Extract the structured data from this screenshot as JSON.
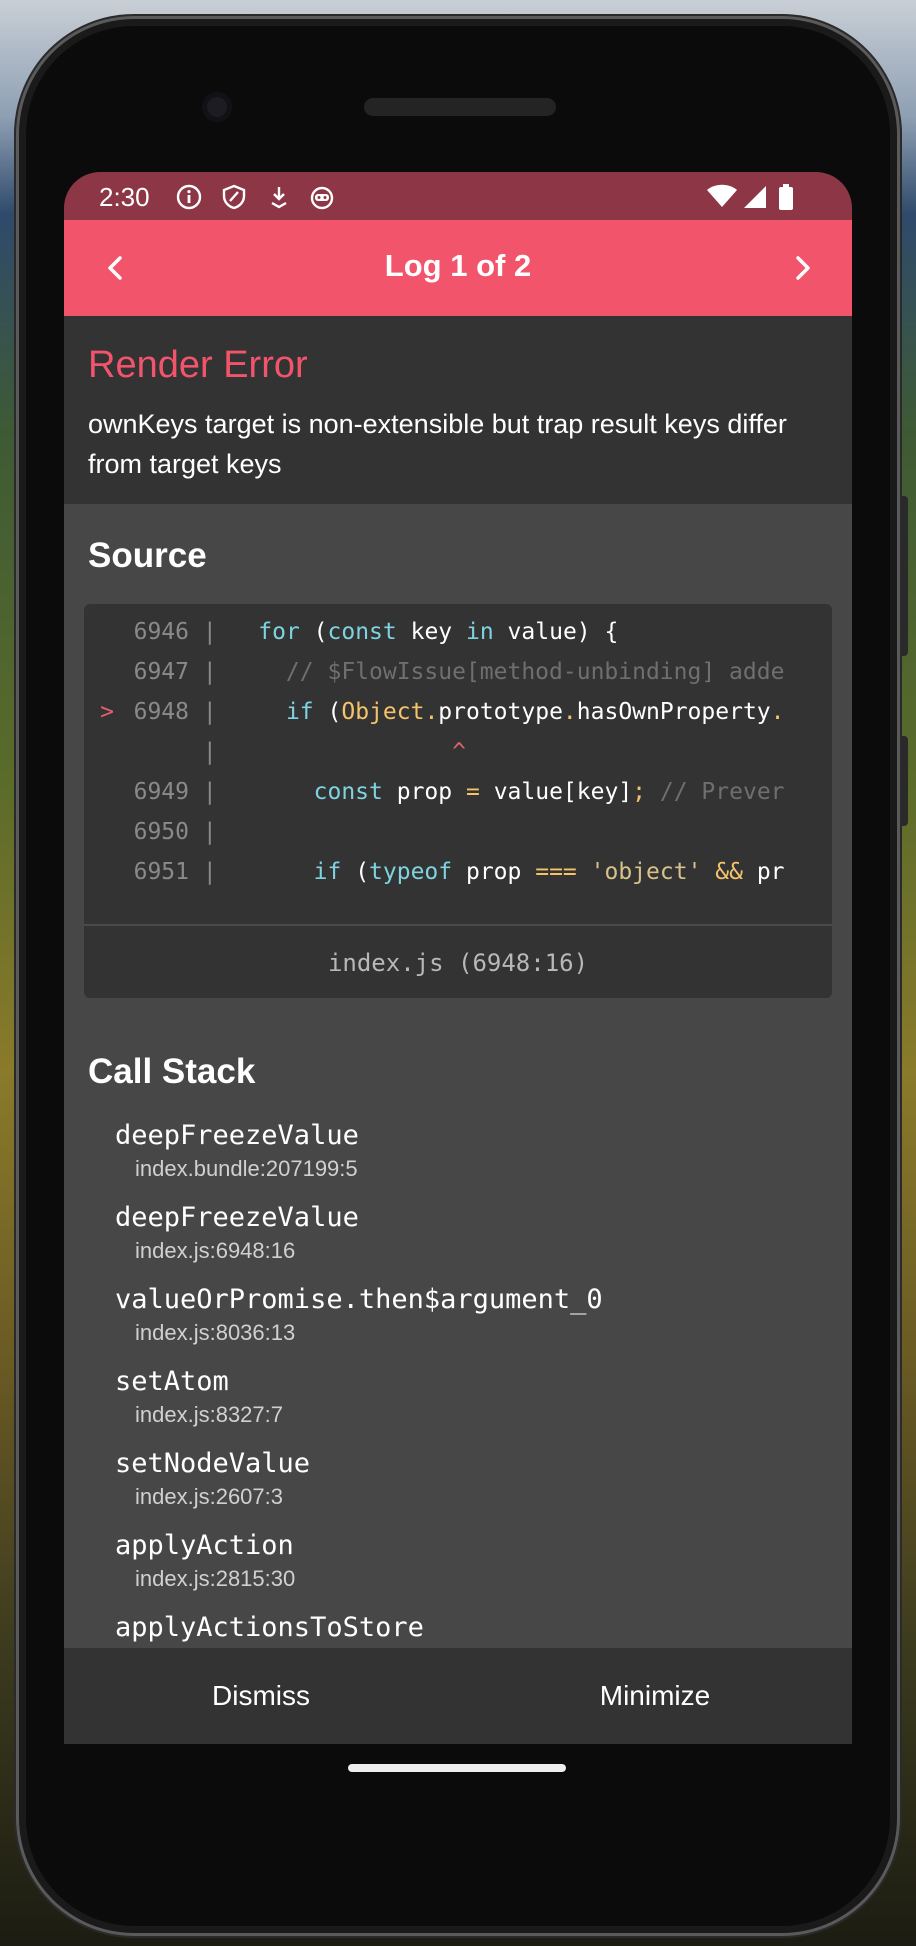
{
  "status_bar": {
    "time": "2:30",
    "left_icons": [
      "info-icon",
      "shield-icon",
      "download-arrow-icon",
      "robot-icon"
    ],
    "right_icons": [
      "wifi-icon",
      "cellular-signal-icon",
      "battery-icon"
    ]
  },
  "header": {
    "title": "Log 1 of 2",
    "prev_icon": "chevron-left-icon",
    "next_icon": "chevron-right-icon",
    "color": "#f2546b"
  },
  "error": {
    "title": "Render Error",
    "message": "ownKeys target is non-extensible but trap result keys differ from target keys",
    "title_color": "#f2546b"
  },
  "source": {
    "heading": "Source",
    "lines": [
      {
        "marker": "",
        "number": "6946",
        "code": "  for (const key in value) {"
      },
      {
        "marker": "",
        "number": "6947",
        "code": "    // $FlowIssue[method-unbinding] adde"
      },
      {
        "marker": ">",
        "number": "6948",
        "code": "    if (Object.prototype.hasOwnProperty."
      },
      {
        "marker": "",
        "number": "",
        "code": "                ^"
      },
      {
        "marker": "",
        "number": "6949",
        "code": "      const prop = value[key]; // Prever"
      },
      {
        "marker": "",
        "number": "6950",
        "code": ""
      },
      {
        "marker": "",
        "number": "6951",
        "code": "      if (typeof prop === 'object' && pr"
      }
    ],
    "location": "index.js (6948:16)"
  },
  "call_stack": {
    "heading": "Call Stack",
    "frames": [
      {
        "fn": "deepFreezeValue",
        "file": "index.bundle:207199:5"
      },
      {
        "fn": "deepFreezeValue",
        "file": "index.js:6948:16"
      },
      {
        "fn": "valueOrPromise.then$argument_0",
        "file": "index.js:8036:13"
      },
      {
        "fn": "setAtom",
        "file": "index.js:8327:7"
      },
      {
        "fn": "setNodeValue",
        "file": "index.js:2607:3"
      },
      {
        "fn": "applyAction",
        "file": "index.js:2815:30"
      },
      {
        "fn": "applyActionsToStore",
        "file": ""
      }
    ]
  },
  "footer": {
    "dismiss_label": "Dismiss",
    "minimize_label": "Minimize"
  }
}
